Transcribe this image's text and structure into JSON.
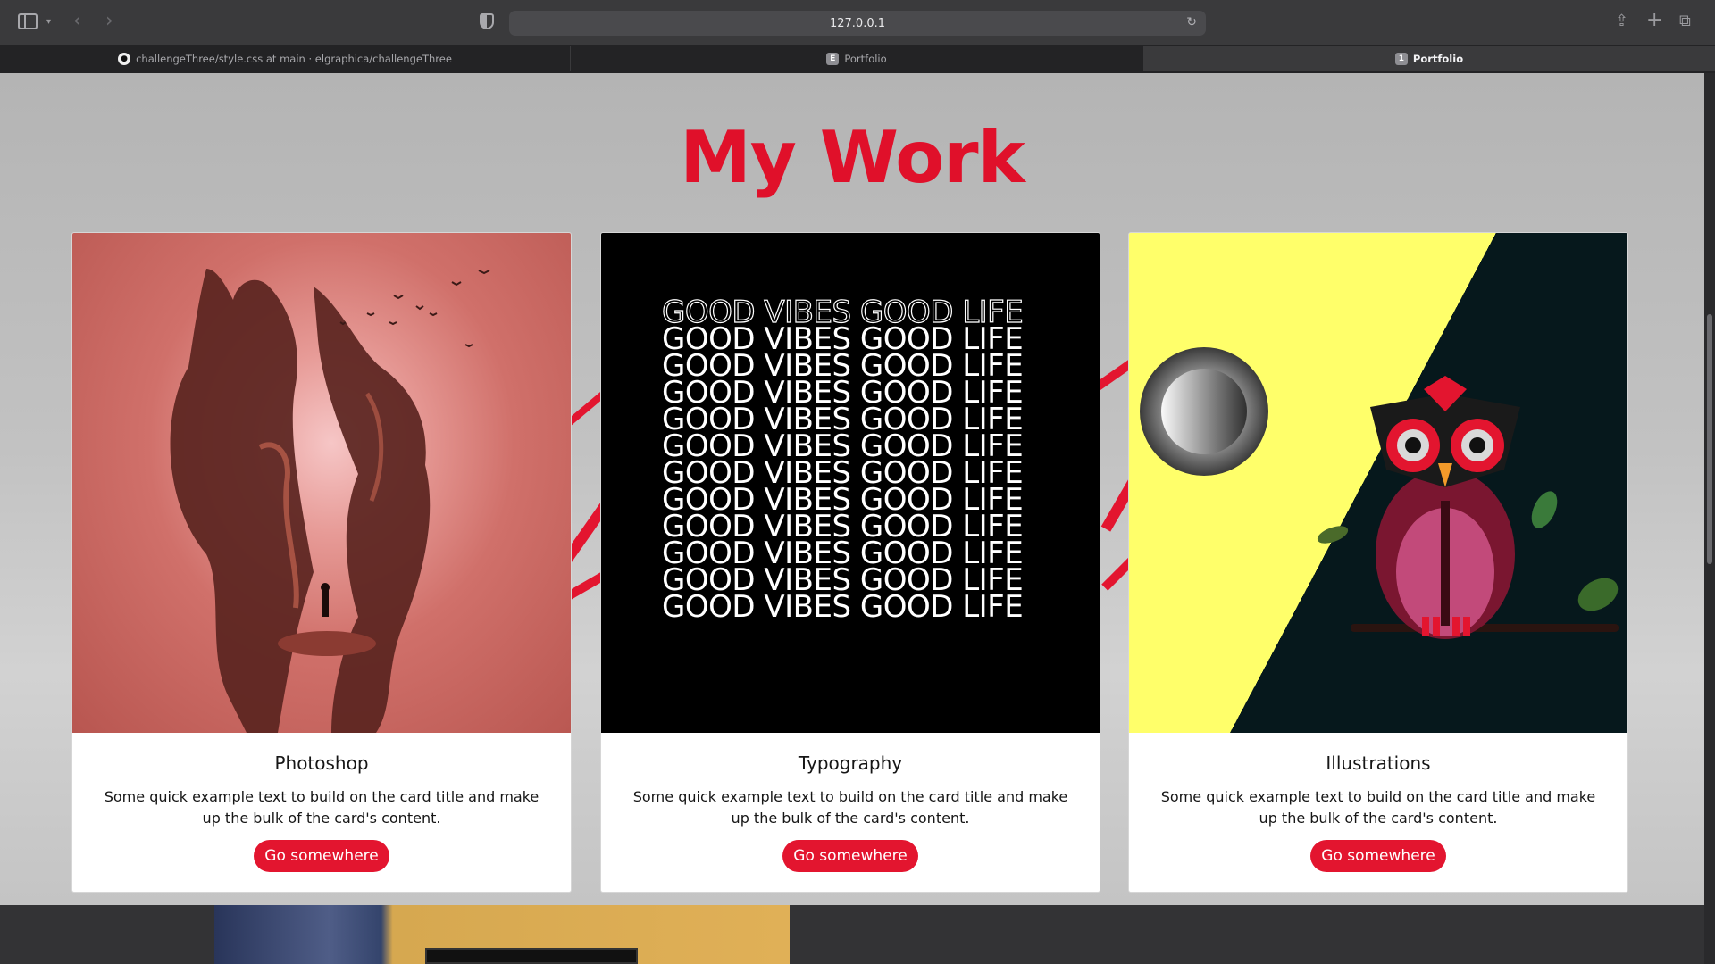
{
  "browser": {
    "address": "127.0.0.1",
    "tabs": [
      {
        "label": "challengeThree/style.css at main · elgraphica/challengeThree",
        "favicon": "github-icon",
        "favicon_text": ""
      },
      {
        "label": "Portfolio",
        "favicon": "e-favicon",
        "favicon_text": "E"
      },
      {
        "label": "Portfolio",
        "favicon": "1-favicon",
        "favicon_text": "1",
        "active": true
      }
    ]
  },
  "page": {
    "title": "My Work",
    "accent_color": "#e3152f",
    "cards": [
      {
        "title": "Photoshop",
        "text": "Some quick example text to build on the card title and make up the bulk of the card's content.",
        "button": "Go somewhere"
      },
      {
        "title": "Typography",
        "text": "Some quick example text to build on the card title and make up the bulk of the card's content.",
        "button": "Go somewhere"
      },
      {
        "title": "Illustrations",
        "text": "Some quick example text to build on the card title and make up the bulk of the card's content.",
        "button": "Go somewhere"
      }
    ],
    "typography_art_text": "GOOD VIBES GOOD LIFE"
  }
}
